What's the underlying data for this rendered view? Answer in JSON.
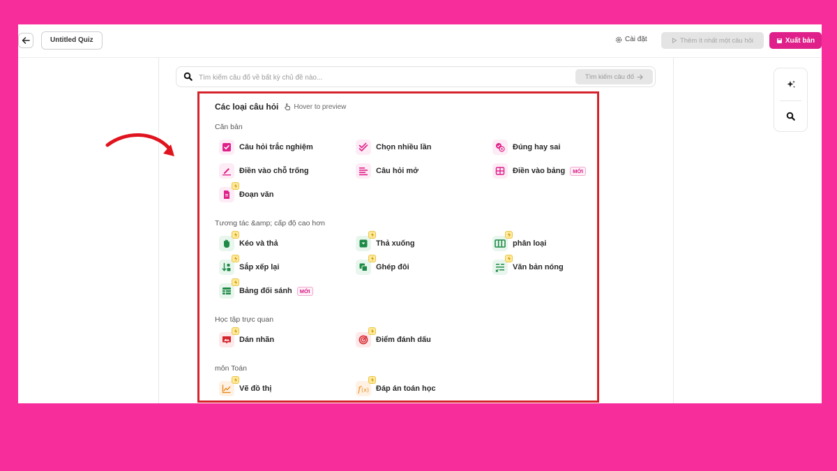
{
  "topbar": {
    "quiz_title": "Untitled Quiz",
    "settings_label": "Cài đặt",
    "add_question_label": "Thêm ít nhất một câu hỏi",
    "publish_label": "Xuất bản"
  },
  "search": {
    "placeholder": "Tìm kiếm câu đố về bất kỳ chủ đề nào...",
    "button_label": "Tìm kiếm câu đố"
  },
  "panel": {
    "title": "Các loại câu hỏi",
    "hint": "Hover to preview",
    "sections": [
      {
        "label": "Căn bản",
        "items": [
          {
            "label": "Câu hỏi trắc nghiệm",
            "icon": "checkbox-icon"
          },
          {
            "label": "Chọn nhiều lần",
            "icon": "double-check-icon"
          },
          {
            "label": "Đúng hay sai",
            "icon": "true-false-icon"
          },
          {
            "label": "Điền vào chỗ trống",
            "icon": "pencil-icon"
          },
          {
            "label": "Câu hỏi mở",
            "icon": "text-lines-icon"
          },
          {
            "label": "Điền vào bảng",
            "icon": "table-icon",
            "badge": "MỚI"
          },
          {
            "label": "Đoạn văn",
            "icon": "document-icon"
          }
        ]
      },
      {
        "label": "Tương tác &amp; cấp độ cao hơn",
        "items": [
          {
            "label": "Kéo và thả",
            "icon": "hand-icon"
          },
          {
            "label": "Thả xuống",
            "icon": "dropdown-icon"
          },
          {
            "label": "phân loại",
            "icon": "columns-icon"
          },
          {
            "label": "Sắp xếp lại",
            "icon": "reorder-icon"
          },
          {
            "label": "Ghép đôi",
            "icon": "match-icon"
          },
          {
            "label": "Văn bản nóng",
            "icon": "hotspot-text-icon"
          },
          {
            "label": "Bảng đối sánh",
            "icon": "grid-icon",
            "badge": "MỚI"
          }
        ]
      },
      {
        "label": "Học tập trực quan",
        "items": [
          {
            "label": "Dán nhãn",
            "icon": "label-image-icon"
          },
          {
            "label": "Điểm đánh dấu",
            "icon": "target-icon"
          }
        ]
      },
      {
        "label": "môn Toán",
        "items": [
          {
            "label": "Vẽ đồ thị",
            "icon": "line-graph-icon"
          },
          {
            "label": "Đáp án toán học",
            "icon": "function-icon"
          }
        ]
      }
    ]
  },
  "colors": {
    "background": "#f72d9c",
    "accent": "#e0208a",
    "highlight_border": "#d6232b",
    "green_icons": "#1e8a46",
    "red_icons": "#d6232b",
    "orange_icons": "#e8891c"
  }
}
